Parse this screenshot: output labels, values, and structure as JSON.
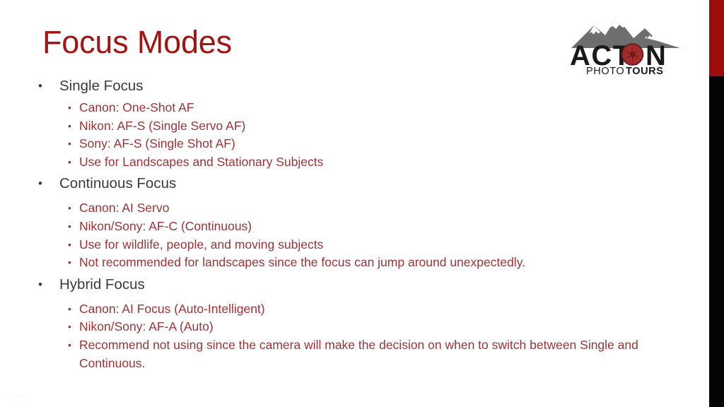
{
  "slide": {
    "title": "Focus Modes",
    "title_color": "#9e1715",
    "background_color": "#ffffff",
    "level1_color": "#3b3b3b",
    "level2_color": "#9c3336",
    "bullet_glyph": "•"
  },
  "edge_bar": {
    "top_color": "#9e0b0b",
    "bottom_color": "#050505"
  },
  "logo": {
    "brand": "ACTION",
    "brand_light": "PHOTO",
    "brand_bold": "TOURS",
    "mountain_color": "#6d6e70",
    "snow_color": "#ffffff",
    "wordmark_color": "#1a1a1a",
    "aperture_color": "#a32c2c",
    "aperture_dark": "#6e1a1a"
  },
  "content": {
    "groups": [
      {
        "heading": "Single Focus",
        "items": [
          "Canon:  One-Shot AF",
          "Nikon: AF-S (Single Servo AF)",
          "Sony: AF-S (Single Shot AF)",
          "Use for Landscapes and Stationary Subjects"
        ]
      },
      {
        "heading": "Continuous Focus",
        "items": [
          "Canon: AI Servo",
          "Nikon/Sony: AF-C (Continuous)",
          "Use for wildlife, people, and moving subjects",
          "Not recommended for landscapes since the focus can jump around unexpectedly."
        ]
      },
      {
        "heading": "Hybrid Focus",
        "items": [
          "Canon: AI Focus (Auto-Intelligent)",
          "Nikon/Sony:  AF-A (Auto)",
          "Recommend not using since the camera will make the decision on when to switch between Single and Continuous."
        ]
      }
    ]
  }
}
